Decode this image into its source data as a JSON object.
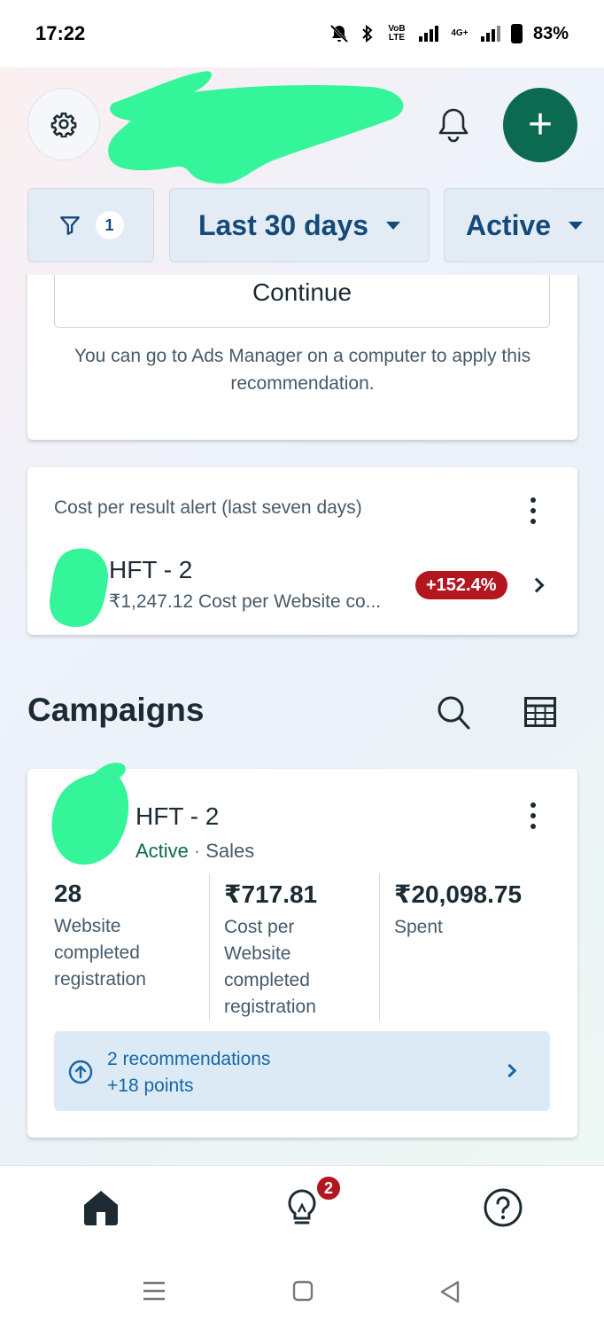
{
  "status_bar": {
    "time": "17:22",
    "network_label": "VoB LTE",
    "network2_label": "4G+",
    "battery": "83%"
  },
  "header": {
    "settings_icon": "gear-icon",
    "notifications_icon": "bell-icon",
    "create_icon": "plus-icon",
    "create_label": "+"
  },
  "filters": {
    "filter_count": "1",
    "date_range": "Last 30 days",
    "status": "Active"
  },
  "recommendation_card": {
    "button_label": "Continue",
    "note": "You can go to Ads Manager on a computer to apply this recommendation."
  },
  "alert_card": {
    "title": "Cost per result alert (last seven days)",
    "campaign_name": "HFT - 2",
    "detail": "₹1,247.12 Cost per Website co...",
    "change": "+152.4%"
  },
  "campaigns": {
    "title": "Campaigns",
    "card": {
      "name": "HFT - 2",
      "status": "Active",
      "separator": "·",
      "objective": "Sales",
      "metrics": [
        {
          "value": "28",
          "label": "Website completed registration"
        },
        {
          "value": "₹717.81",
          "label": "Cost per Website completed registration"
        },
        {
          "value": "₹20,098.75",
          "label": "Spent"
        }
      ],
      "recommendations": {
        "line1": "2 recommendations",
        "line2": "+18 points"
      }
    }
  },
  "bottom_nav": {
    "items": [
      "home-icon",
      "lightbulb-icon",
      "help-icon"
    ],
    "notification_count": "2"
  },
  "colors": {
    "brand_green": "#0b6a4f",
    "link_blue": "#14497a",
    "alert_red": "#b3161f",
    "redaction": "#35f59a"
  }
}
